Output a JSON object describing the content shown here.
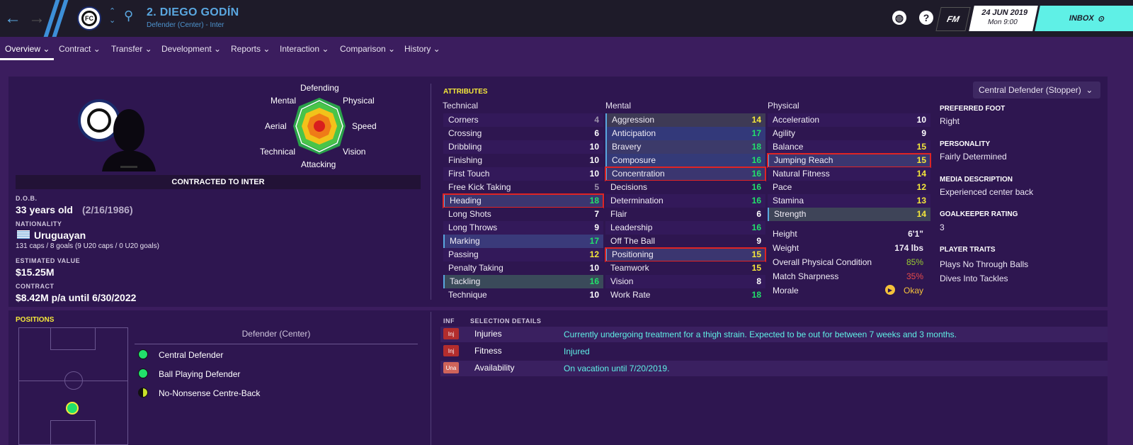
{
  "header": {
    "player_name": "2. DIEGO GODÍN",
    "player_subtitle": "Defender (Center) - Inter",
    "fm_label": "FM",
    "date": "24 JUN 2019",
    "time": "Mon 9:00",
    "inbox_label": "INBOX"
  },
  "tabs": [
    "Overview",
    "Contract",
    "Transfer",
    "Development",
    "Reports",
    "Interaction",
    "Comparison",
    "History"
  ],
  "radar": {
    "top": "Defending",
    "top_right": "Physical",
    "right": "Speed",
    "bottom_right": "Vision",
    "bottom": "Attacking",
    "bottom_left": "Technical",
    "left": "Aerial",
    "top_left": "Mental"
  },
  "profile": {
    "contract_banner": "CONTRACTED TO INTER",
    "dob_label": "D.O.B.",
    "age": "33 years old",
    "dob": "(2/16/1986)",
    "nationality_label": "NATIONALITY",
    "nationality": "Uruguayan",
    "caps": "131 caps / 8 goals (9 U20 caps / 0 U20 goals)",
    "value_label": "ESTIMATED VALUE",
    "value": "$15.25M",
    "contract_label": "CONTRACT",
    "contract": "$8.42M p/a until 6/30/2022"
  },
  "attributes": {
    "heading": "ATTRIBUTES",
    "role_selector": "Central Defender (Stopper)",
    "technical_title": "Technical",
    "mental_title": "Mental",
    "physical_title": "Physical",
    "technical": [
      {
        "name": "Corners",
        "value": "4"
      },
      {
        "name": "Crossing",
        "value": "6"
      },
      {
        "name": "Dribbling",
        "value": "10"
      },
      {
        "name": "Finishing",
        "value": "10"
      },
      {
        "name": "First Touch",
        "value": "10"
      },
      {
        "name": "Free Kick Taking",
        "value": "5"
      },
      {
        "name": "Heading",
        "value": "18"
      },
      {
        "name": "Long Shots",
        "value": "7"
      },
      {
        "name": "Long Throws",
        "value": "9"
      },
      {
        "name": "Marking",
        "value": "17"
      },
      {
        "name": "Passing",
        "value": "12"
      },
      {
        "name": "Penalty Taking",
        "value": "10"
      },
      {
        "name": "Tackling",
        "value": "16"
      },
      {
        "name": "Technique",
        "value": "10"
      }
    ],
    "mental": [
      {
        "name": "Aggression",
        "value": "14"
      },
      {
        "name": "Anticipation",
        "value": "17"
      },
      {
        "name": "Bravery",
        "value": "18"
      },
      {
        "name": "Composure",
        "value": "16"
      },
      {
        "name": "Concentration",
        "value": "16"
      },
      {
        "name": "Decisions",
        "value": "16"
      },
      {
        "name": "Determination",
        "value": "16"
      },
      {
        "name": "Flair",
        "value": "6"
      },
      {
        "name": "Leadership",
        "value": "16"
      },
      {
        "name": "Off The Ball",
        "value": "9"
      },
      {
        "name": "Positioning",
        "value": "15"
      },
      {
        "name": "Teamwork",
        "value": "15"
      },
      {
        "name": "Vision",
        "value": "8"
      },
      {
        "name": "Work Rate",
        "value": "18"
      }
    ],
    "physical": [
      {
        "name": "Acceleration",
        "value": "10"
      },
      {
        "name": "Agility",
        "value": "9"
      },
      {
        "name": "Balance",
        "value": "15"
      },
      {
        "name": "Jumping Reach",
        "value": "15"
      },
      {
        "name": "Natural Fitness",
        "value": "14"
      },
      {
        "name": "Pace",
        "value": "12"
      },
      {
        "name": "Stamina",
        "value": "13"
      },
      {
        "name": "Strength",
        "value": "14"
      }
    ],
    "details": [
      {
        "name": "Height",
        "value": "6'1\""
      },
      {
        "name": "Weight",
        "value": "174 lbs"
      },
      {
        "name": "Overall Physical Condition",
        "value": "85%"
      },
      {
        "name": "Match Sharpness",
        "value": "35%"
      },
      {
        "name": "Morale",
        "value": "Okay"
      }
    ]
  },
  "side": {
    "foot_label": "PREFERRED FOOT",
    "foot": "Right",
    "personality_label": "PERSONALITY",
    "personality": "Fairly Determined",
    "media_label": "MEDIA DESCRIPTION",
    "media": "Experienced center back",
    "gk_label": "GOALKEEPER RATING",
    "gk": "3",
    "traits_label": "PLAYER TRAITS",
    "trait1": "Plays No Through Balls",
    "trait2": "Dives Into Tackles"
  },
  "positions": {
    "heading": "POSITIONS",
    "main": "Defender (Center)",
    "roles": [
      "Central Defender",
      "Ball Playing Defender",
      "No-Nonsense Centre-Back"
    ]
  },
  "selection": {
    "inf_label": "INF",
    "heading": "SELECTION DETAILS",
    "rows": [
      {
        "badge": "Inj",
        "label": "Injuries",
        "text": "Currently undergoing treatment for a thigh strain. Expected to be out for between 7 weeks and 3 months."
      },
      {
        "badge": "Inj",
        "label": "Fitness",
        "text": "Injured"
      },
      {
        "badge": "Una",
        "label": "Availability",
        "text": "On vacation until 7/20/2019."
      }
    ]
  },
  "colors": {
    "accent_blue": "#5aa7e0",
    "cyan": "#5ff0e6",
    "green": "#22e06b",
    "yellow": "#f5e83a",
    "red": "#e02424"
  }
}
